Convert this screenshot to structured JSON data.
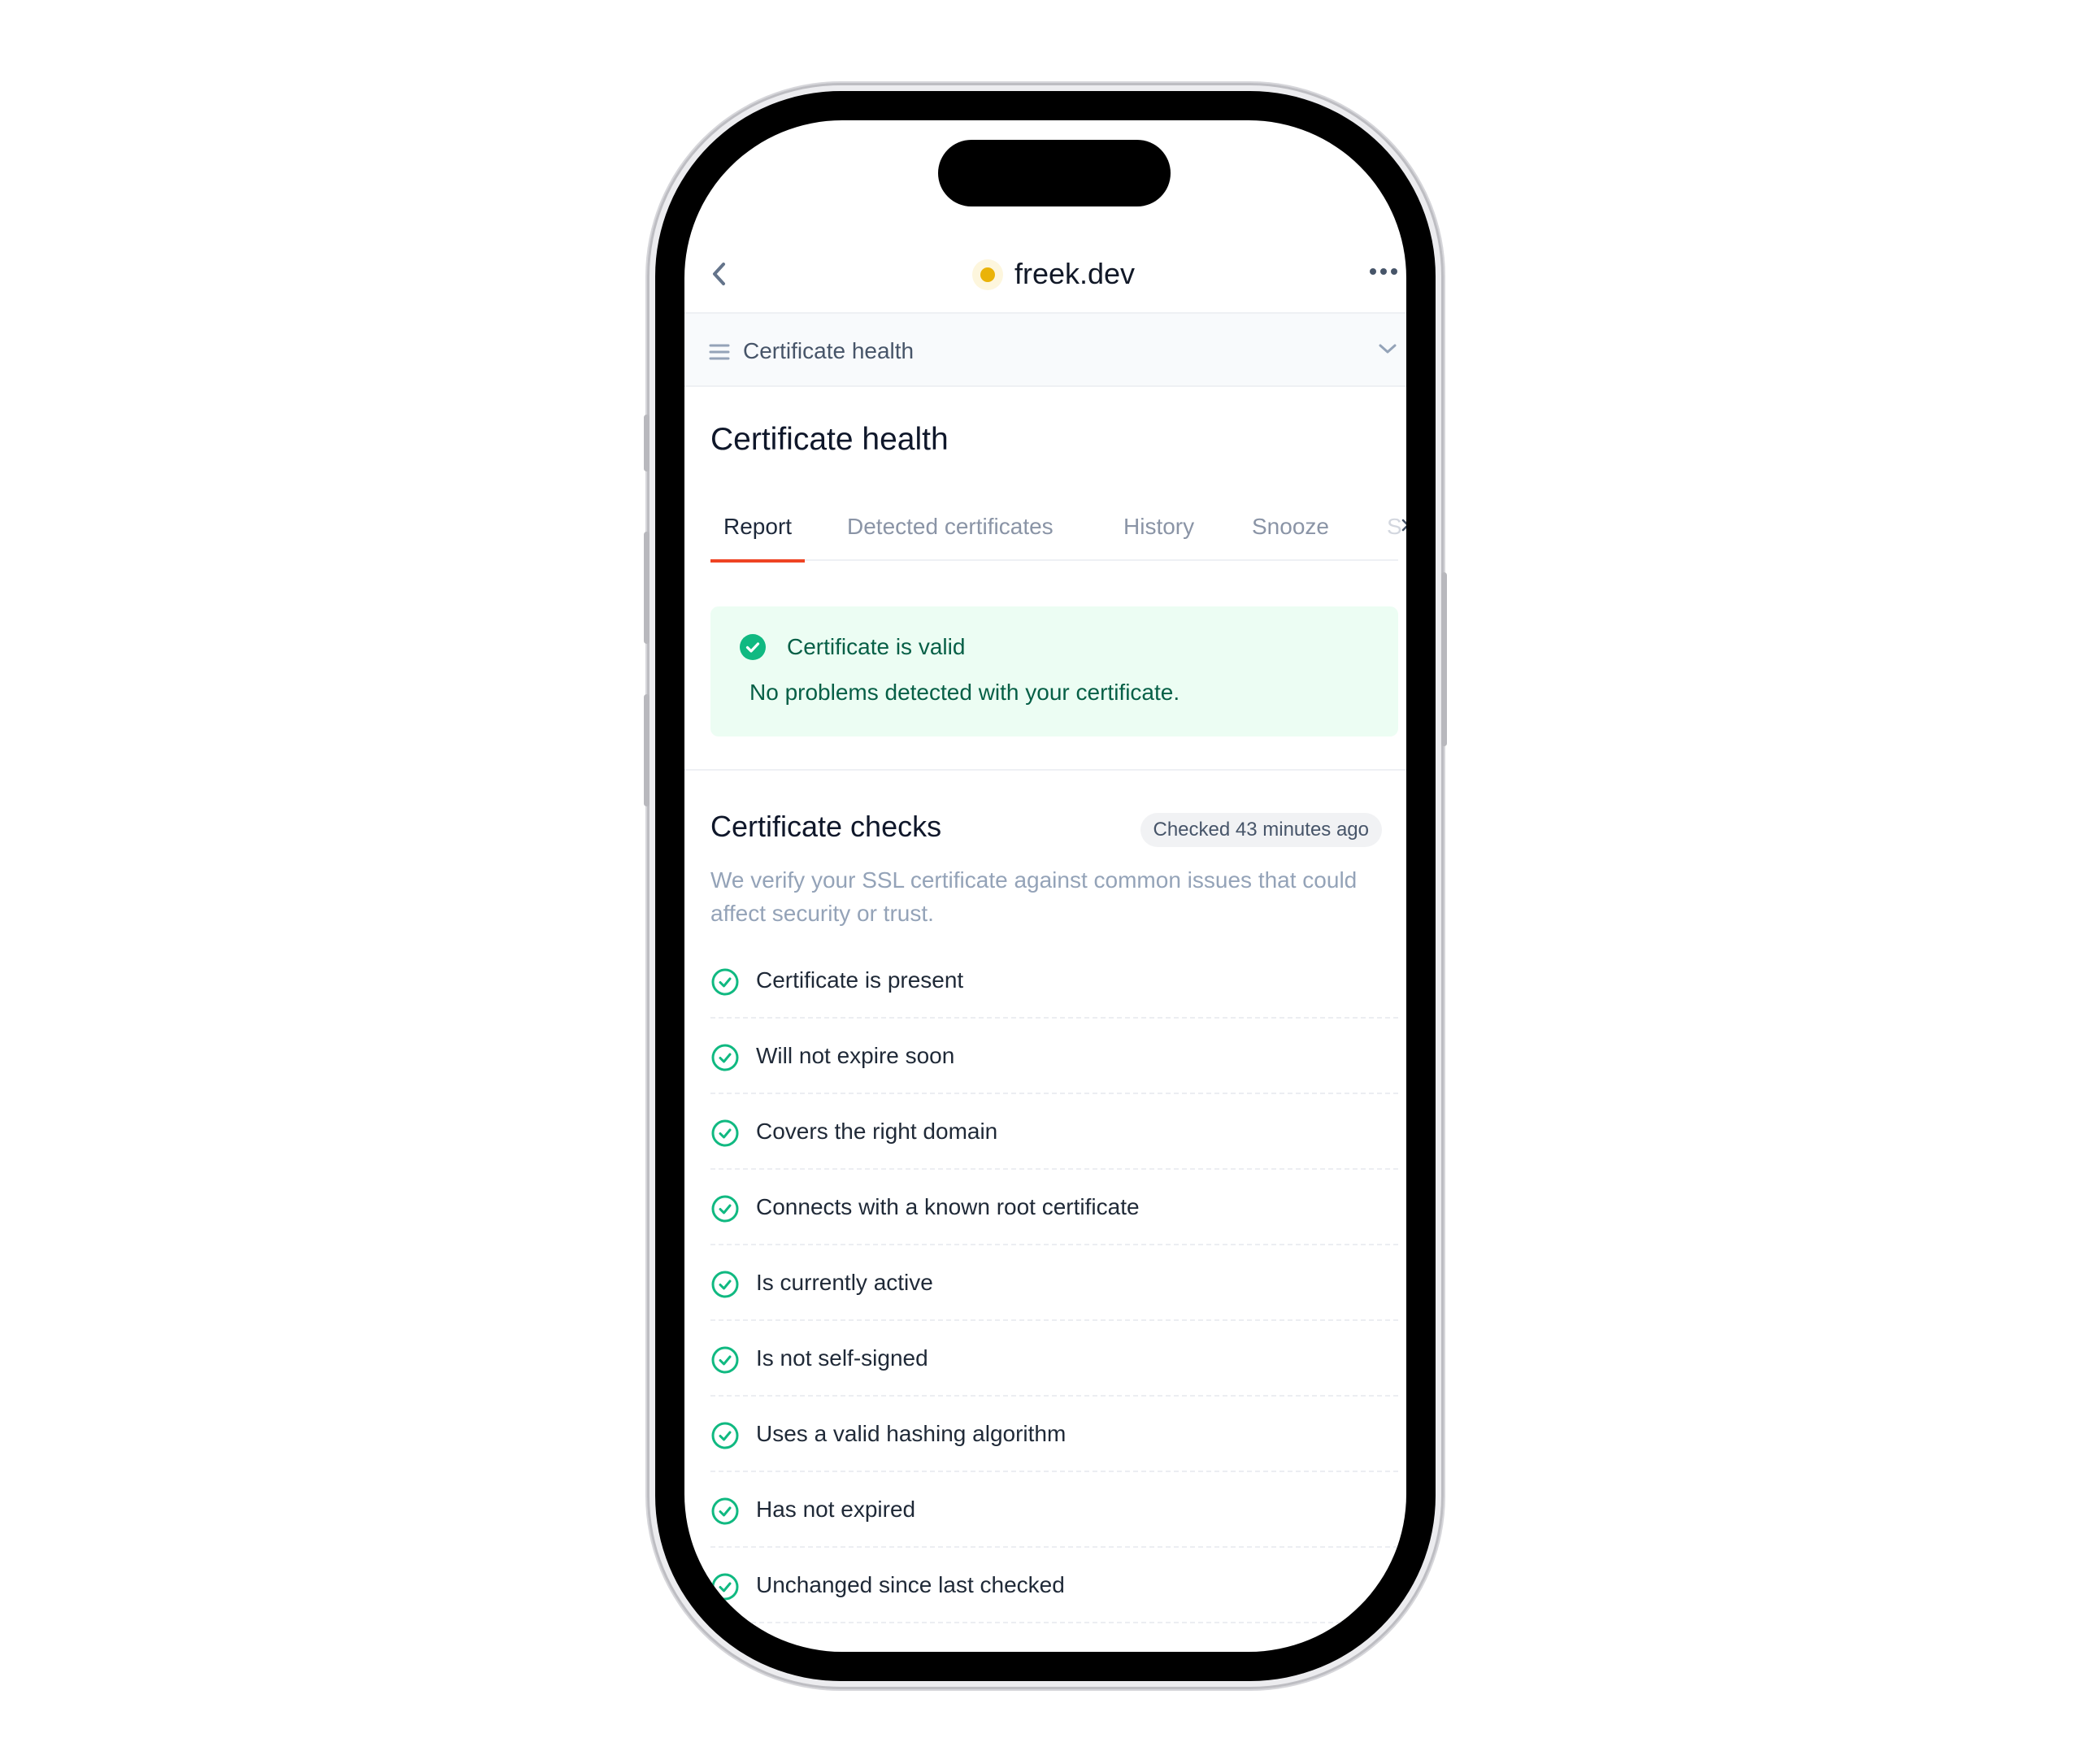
{
  "header": {
    "site_name": "freek.dev",
    "status_color": "#eab308",
    "back_icon": "chevron-left-icon",
    "more_icon": "more-horizontal-icon"
  },
  "section_selector": {
    "label": "Certificate health",
    "icon": "menu-icon",
    "chevron": "chevron-down-icon"
  },
  "page": {
    "title": "Certificate health"
  },
  "tabs": [
    {
      "label": "Report",
      "active": true
    },
    {
      "label": "Detected certificates",
      "active": false
    },
    {
      "label": "History",
      "active": false
    },
    {
      "label": "Snooze",
      "active": false
    },
    {
      "label": "S",
      "active": false
    }
  ],
  "alert": {
    "title": "Certificate is valid",
    "description": "No problems detected with your certificate.",
    "icon": "check-circle-icon",
    "color": "#10b981"
  },
  "checks": {
    "title": "Certificate checks",
    "badge": "Checked 43 minutes ago",
    "description": "We verify your SSL certificate against common issues that could affect security or trust.",
    "items": [
      "Certificate is present",
      "Will not expire soon",
      "Covers the right domain",
      "Connects with a known root certificate",
      "Is currently active",
      "Is not self-signed",
      "Uses a valid hashing algorithm",
      "Has not expired",
      "Unchanged since last checked"
    ]
  },
  "colors": {
    "accent": "#ef4423",
    "success": "#10b981"
  }
}
